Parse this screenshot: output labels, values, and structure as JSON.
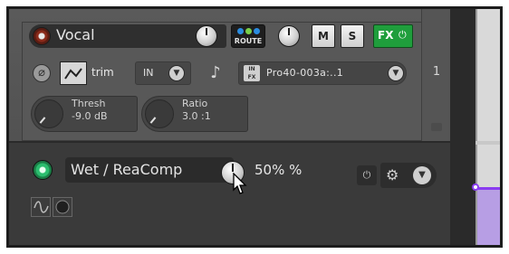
{
  "track": {
    "name": "Vocal",
    "number": "1",
    "route_label": "ROUTE",
    "mute_label": "M",
    "solo_label": "S",
    "fx_label": "FX",
    "fx_power_icon": "power-icon",
    "trim_label": "trim",
    "input_label": "IN",
    "fx_chain_label": "Pro40-003a:..1",
    "in_fx_label": "IN FX"
  },
  "params": [
    {
      "label": "Thresh",
      "value": "-9.0 dB"
    },
    {
      "label": "Ratio",
      "value": "3.0 :1"
    }
  ],
  "fx_lane": {
    "label": "Wet / ReaComp",
    "value": "50% %"
  },
  "colors": {
    "fx_active": "#1f9e3c",
    "record_arm": "#8a2a1a",
    "lane_led": "#2bbd6e",
    "envelope": "#8a3cf0"
  }
}
